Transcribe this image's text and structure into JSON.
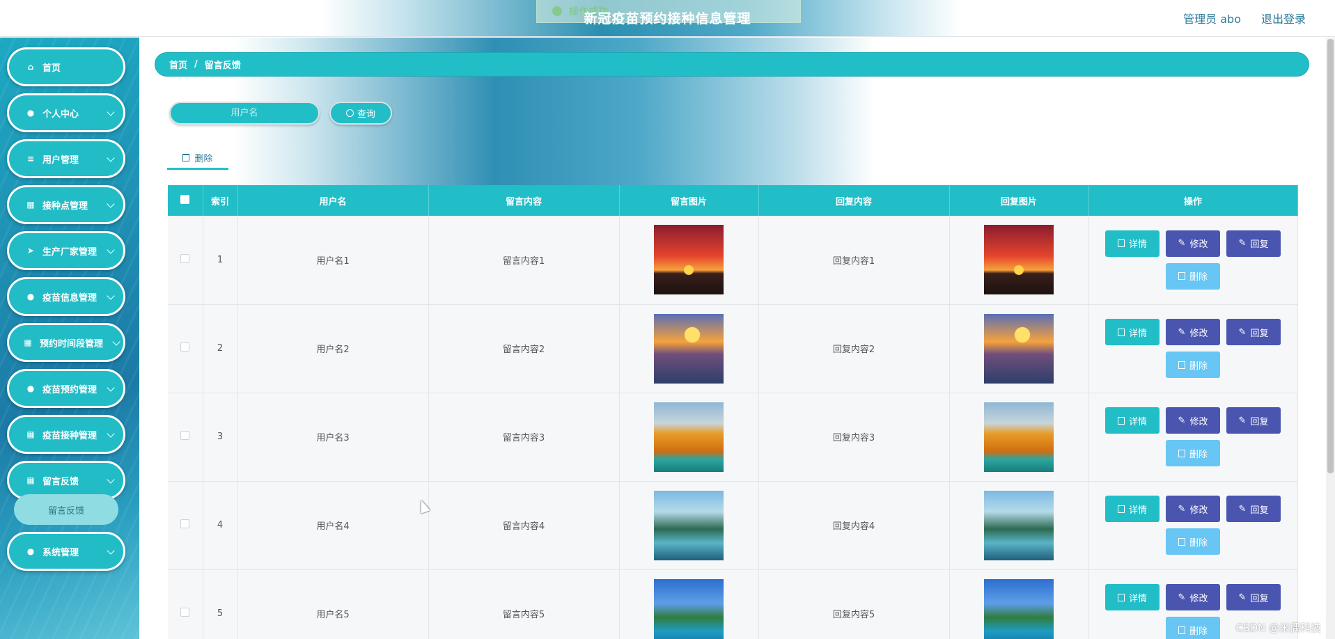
{
  "header": {
    "toast_text": "操作成功",
    "title": "新冠疫苗预约接种信息管理",
    "user": "管理员 abo",
    "logout": "退出登录"
  },
  "sidebar": {
    "items": [
      {
        "label": "首页",
        "icon": "home-icon"
      },
      {
        "label": "个人中心",
        "icon": "user-icon"
      },
      {
        "label": "用户管理",
        "icon": "sliders-icon"
      },
      {
        "label": "接种点管理",
        "icon": "grid-icon"
      },
      {
        "label": "生产厂家管理",
        "icon": "send-icon"
      },
      {
        "label": "疫苗信息管理",
        "icon": "location-icon"
      },
      {
        "label": "预约时间段管理",
        "icon": "grid-icon"
      },
      {
        "label": "疫苗预约管理",
        "icon": "user-icon"
      },
      {
        "label": "疫苗接种管理",
        "icon": "grid-icon"
      },
      {
        "label": "留言反馈",
        "icon": "grid-icon"
      },
      {
        "label": "系统管理",
        "icon": "user-icon"
      }
    ],
    "sub_item": "留言反馈"
  },
  "breadcrumb": {
    "home": "首页",
    "sep": "/",
    "current": "留言反馈"
  },
  "search": {
    "placeholder": "用户名",
    "button": "查询"
  },
  "toolbar": {
    "delete": "删除"
  },
  "table": {
    "headers": [
      "索引",
      "用户名",
      "留言内容",
      "留言图片",
      "回复内容",
      "回复图片",
      "操作"
    ],
    "rows": [
      {
        "index": "1",
        "username": "用户名1",
        "content": "留言内容1",
        "reply": "回复内容1"
      },
      {
        "index": "2",
        "username": "用户名2",
        "content": "留言内容2",
        "reply": "回复内容2"
      },
      {
        "index": "3",
        "username": "用户名3",
        "content": "留言内容3",
        "reply": "回复内容3"
      },
      {
        "index": "4",
        "username": "用户名4",
        "content": "留言内容4",
        "reply": "回复内容4"
      },
      {
        "index": "5",
        "username": "用户名5",
        "content": "留言内容5",
        "reply": "回复内容5"
      }
    ],
    "ops": {
      "detail": "详情",
      "edit": "修改",
      "reply": "回复",
      "delete": "删除"
    }
  },
  "watermark": "CSDN @米偶科技",
  "colors": {
    "accent": "#22bec8",
    "purple": "#4a55b0",
    "light_blue": "#67c6f3"
  }
}
